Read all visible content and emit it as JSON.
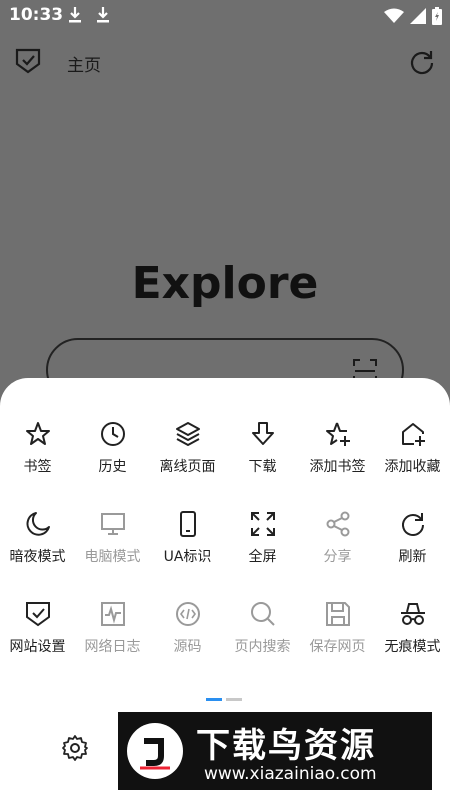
{
  "status_bar": {
    "time": "10:33"
  },
  "top_bar": {
    "title": "主页"
  },
  "main": {
    "headline": "Explore"
  },
  "menu": {
    "rows": [
      [
        {
          "label": "书签",
          "icon": "star-icon",
          "enabled": true
        },
        {
          "label": "历史",
          "icon": "clock-icon",
          "enabled": true
        },
        {
          "label": "离线页面",
          "icon": "layers-icon",
          "enabled": true
        },
        {
          "label": "下载",
          "icon": "download-arrow-icon",
          "enabled": true
        },
        {
          "label": "添加书签",
          "icon": "star-plus-icon",
          "enabled": true
        },
        {
          "label": "添加收藏",
          "icon": "home-plus-icon",
          "enabled": true
        }
      ],
      [
        {
          "label": "暗夜模式",
          "icon": "moon-icon",
          "enabled": true
        },
        {
          "label": "电脑模式",
          "icon": "desktop-icon",
          "enabled": false
        },
        {
          "label": "UA标识",
          "icon": "phone-icon",
          "enabled": true
        },
        {
          "label": "全屏",
          "icon": "fullscreen-icon",
          "enabled": true
        },
        {
          "label": "分享",
          "icon": "share-icon",
          "enabled": false
        },
        {
          "label": "刷新",
          "icon": "refresh-icon",
          "enabled": true
        }
      ],
      [
        {
          "label": "网站设置",
          "icon": "shield-check-icon",
          "enabled": true
        },
        {
          "label": "网络日志",
          "icon": "pulse-log-icon",
          "enabled": false
        },
        {
          "label": "源码",
          "icon": "code-icon",
          "enabled": false
        },
        {
          "label": "页内搜索",
          "icon": "search-icon",
          "enabled": false
        },
        {
          "label": "保存网页",
          "icon": "save-icon",
          "enabled": false
        },
        {
          "label": "无痕模式",
          "icon": "incognito-icon",
          "enabled": true
        }
      ]
    ],
    "pager": {
      "active_page": 1,
      "page_count": 2
    }
  },
  "watermark": {
    "title": "下载鸟资源",
    "url": "www.xiazainiao.com"
  },
  "colors": {
    "overlay": "#6f6f6f",
    "disabled": "#9a9a9a",
    "pager_active": "#2a8ff0",
    "icon": "#222222"
  }
}
